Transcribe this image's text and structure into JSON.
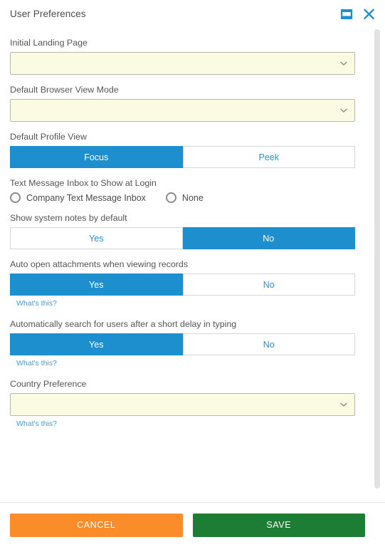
{
  "window": {
    "title": "User Preferences",
    "restore_icon": "window-restore-icon",
    "close_icon": "close-icon"
  },
  "theme": {
    "accent_blue": "#1d8fcf",
    "link_blue": "#3a9fe0",
    "field_yellow": "#fbfbe3",
    "cancel_orange": "#fb8c2a",
    "save_green": "#1d7d35",
    "label_gray": "#555555"
  },
  "form": {
    "fields": [
      {
        "id": "initial-landing-page",
        "type": "select",
        "label": "Initial Landing Page",
        "value": "",
        "icon": "chevron-down-icon",
        "help": null
      },
      {
        "id": "default-browser-view-mode",
        "type": "select",
        "label": "Default Browser View Mode",
        "value": "",
        "icon": "chevron-down-icon",
        "help": null
      },
      {
        "id": "default-profile-view",
        "type": "segmented",
        "label": "Default Profile View",
        "options": [
          "Focus",
          "Peek"
        ],
        "selected": "Focus",
        "help": null
      },
      {
        "id": "text-message-inbox",
        "type": "radio",
        "label": "Text Message Inbox to Show at Login",
        "options": [
          "Company Text Message Inbox",
          "None"
        ],
        "selected": "",
        "help": null
      },
      {
        "id": "show-system-notes",
        "type": "segmented",
        "label": "Show system notes by default",
        "options": [
          "Yes",
          "No"
        ],
        "selected": "No",
        "help": null
      },
      {
        "id": "auto-open-attachments",
        "type": "segmented",
        "label": "Auto open attachments when viewing records",
        "options": [
          "Yes",
          "No"
        ],
        "selected": "Yes",
        "help": "What's this?"
      },
      {
        "id": "auto-search-users",
        "type": "segmented",
        "label": "Automatically search for users after a short delay in typing",
        "options": [
          "Yes",
          "No"
        ],
        "selected": "Yes",
        "help": "What's this?"
      },
      {
        "id": "country-preference",
        "type": "select",
        "label": "Country Preference",
        "value": "",
        "icon": "chevron-down-icon",
        "help": "What's this?"
      }
    ]
  },
  "footer": {
    "cancel_label": "CANCEL",
    "save_label": "SAVE"
  }
}
